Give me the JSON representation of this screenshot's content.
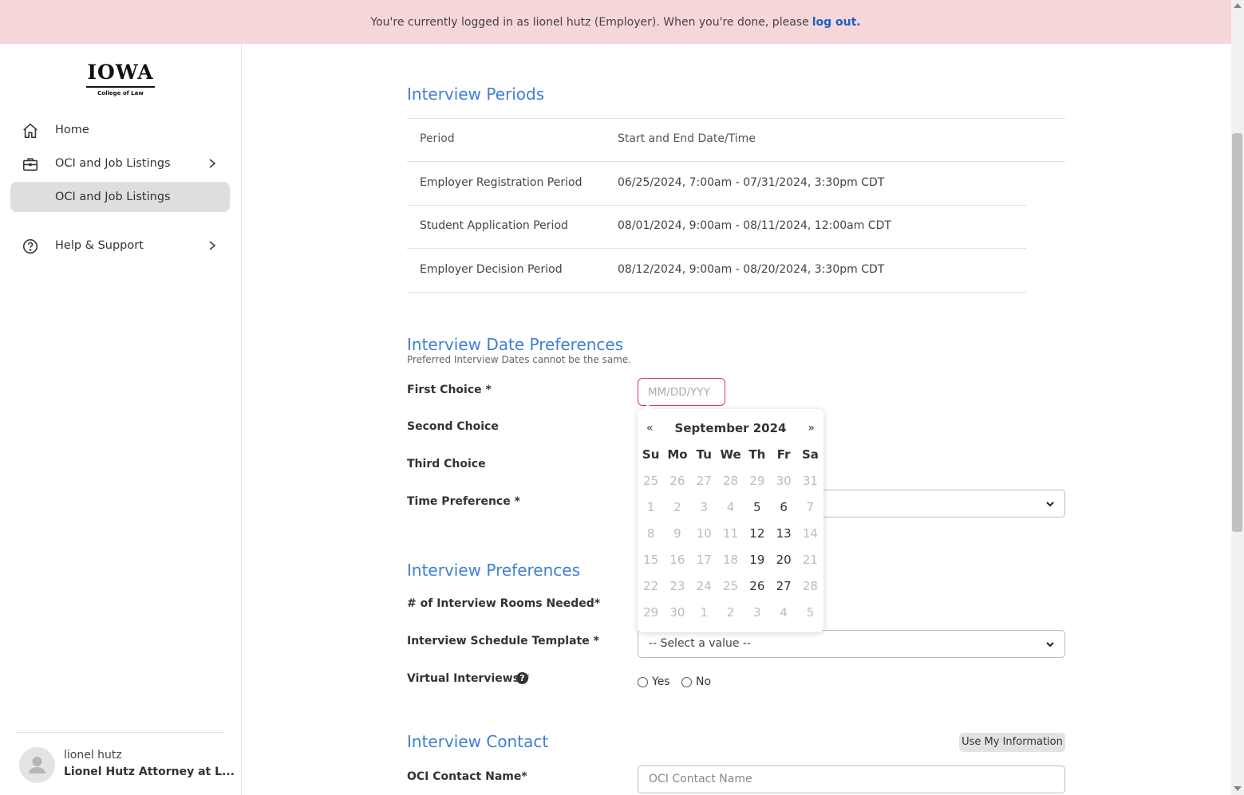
{
  "banner": {
    "text": "You're currently logged in as lionel hutz (Employer). When you're done, please",
    "link": "log out."
  },
  "sidebar": {
    "logo_word": "IOWA",
    "logo_sub": "College of Law",
    "items": [
      {
        "label": "Home",
        "icon": "home-icon"
      },
      {
        "label": "OCI and Job Listings",
        "icon": "briefcase-icon"
      },
      {
        "label": "OCI and Job Listings"
      },
      {
        "label": "Help & Support",
        "icon": "question-circle-icon"
      }
    ],
    "user": {
      "name": "lionel hutz",
      "org": "Lionel Hutz Attorney at L..."
    }
  },
  "periods": {
    "heading": "Interview Periods",
    "col_period": "Period",
    "col_dates": "Start and End Date/Time",
    "rows": [
      {
        "period": "Employer Registration Period",
        "dates": "06/25/2024, 7:00am - 07/31/2024, 3:30pm CDT"
      },
      {
        "period": "Student Application Period",
        "dates": "08/01/2024, 9:00am - 08/11/2024, 12:00am CDT"
      },
      {
        "period": "Employer Decision Period",
        "dates": "08/12/2024, 9:00am - 08/20/2024, 3:30pm CDT"
      }
    ]
  },
  "date_prefs": {
    "heading": "Interview Date Preferences",
    "note": "Preferred Interview Dates cannot be the same.",
    "first_label": "First Choice *",
    "first_placeholder": "MM/DD/YYY",
    "second_label": "Second Choice",
    "third_label": "Third Choice",
    "time_label": "Time Preference *"
  },
  "calendar": {
    "prev": "«",
    "next": "»",
    "title": "September 2024",
    "days_of_week": [
      "Su",
      "Mo",
      "Tu",
      "We",
      "Th",
      "Fr",
      "Sa"
    ],
    "weeks": [
      [
        {
          "d": "25",
          "on": false
        },
        {
          "d": "26",
          "on": false
        },
        {
          "d": "27",
          "on": false
        },
        {
          "d": "28",
          "on": false
        },
        {
          "d": "29",
          "on": false
        },
        {
          "d": "30",
          "on": false
        },
        {
          "d": "31",
          "on": false
        }
      ],
      [
        {
          "d": "1",
          "on": false
        },
        {
          "d": "2",
          "on": false
        },
        {
          "d": "3",
          "on": false
        },
        {
          "d": "4",
          "on": false
        },
        {
          "d": "5",
          "on": true
        },
        {
          "d": "6",
          "on": true
        },
        {
          "d": "7",
          "on": false
        }
      ],
      [
        {
          "d": "8",
          "on": false
        },
        {
          "d": "9",
          "on": false
        },
        {
          "d": "10",
          "on": false
        },
        {
          "d": "11",
          "on": false
        },
        {
          "d": "12",
          "on": true
        },
        {
          "d": "13",
          "on": true
        },
        {
          "d": "14",
          "on": false
        }
      ],
      [
        {
          "d": "15",
          "on": false
        },
        {
          "d": "16",
          "on": false
        },
        {
          "d": "17",
          "on": false
        },
        {
          "d": "18",
          "on": false
        },
        {
          "d": "19",
          "on": true
        },
        {
          "d": "20",
          "on": true
        },
        {
          "d": "21",
          "on": false
        }
      ],
      [
        {
          "d": "22",
          "on": false
        },
        {
          "d": "23",
          "on": false
        },
        {
          "d": "24",
          "on": false
        },
        {
          "d": "25",
          "on": false
        },
        {
          "d": "26",
          "on": true
        },
        {
          "d": "27",
          "on": true
        },
        {
          "d": "28",
          "on": false
        }
      ],
      [
        {
          "d": "29",
          "on": false
        },
        {
          "d": "30",
          "on": false
        },
        {
          "d": "1",
          "on": false
        },
        {
          "d": "2",
          "on": false
        },
        {
          "d": "3",
          "on": false
        },
        {
          "d": "4",
          "on": false
        },
        {
          "d": "5",
          "on": false
        }
      ]
    ]
  },
  "interview_prefs": {
    "heading": "Interview Preferences",
    "rooms_label": "# of Interview Rooms Needed*",
    "template_label": "Interview Schedule Template *",
    "template_value": "-- Select a value --",
    "virtual_label": "Virtual Interviews *",
    "yes": "Yes",
    "no": "No"
  },
  "contact": {
    "heading": "Interview Contact",
    "use_info_button": "Use My Information",
    "name_label": "OCI Contact Name*",
    "name_placeholder": "OCI Contact Name"
  },
  "colors": {
    "accent": "#3f7ed6",
    "banner": "#f5d6d9",
    "error": "#d33a4d",
    "link": "#1d5fbf"
  }
}
